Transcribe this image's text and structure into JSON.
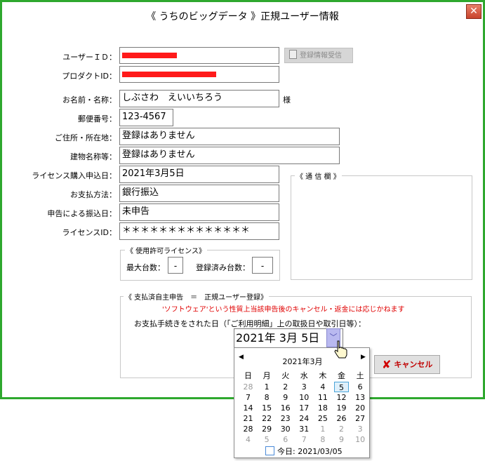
{
  "window": {
    "title": "《 うちのビッグデータ 》正規ユーザー情報",
    "close_glyph": "✕"
  },
  "fields": {
    "user_id": {
      "label": "ユーザーＩＤ：",
      "value": ""
    },
    "product_id": {
      "label": "プロダクトID：",
      "value": ""
    },
    "name": {
      "label": "お名前・名称：",
      "value": "しぶさわ　えいいちろう",
      "suffix": "様"
    },
    "postal": {
      "label": "郵便番号：",
      "value": "123-4567"
    },
    "address": {
      "label": "ご住所・所在地：",
      "value": "登録はありません"
    },
    "building": {
      "label": "建物名称等：",
      "value": "登録はありません"
    },
    "purchase_date": {
      "label": "ライセンス購入申込日：",
      "value": "2021年3月5日"
    },
    "payment_method": {
      "label": "お支払方法：",
      "value": "銀行振込"
    },
    "transfer_date": {
      "label": "申告による振込日：",
      "value": "未申告"
    },
    "license_id": {
      "label": "ライセンスID：",
      "value": "＊＊＊＊＊＊＊＊＊＊＊＊＊＊"
    }
  },
  "receive_button": {
    "label": "登録情報受信"
  },
  "license_group": {
    "title": "《 使用許可ライセンス》",
    "max_label": "最大台数：",
    "max_value": "-",
    "registered_label": "登録済み台数：",
    "registered_value": "-"
  },
  "comm_group": {
    "title": "《 通 信 欄 》"
  },
  "declare_group": {
    "title": "《 支払済自主申告　＝　正規ユーザー登録》",
    "warning": "'ソフトウェア'という性質上当該申告後のキャンセル・返金には応じかねます",
    "prompt": "お支払手続きをされた日（「ご利用明細」上の取扱日や取引日等）：",
    "date_value": "2021年  3月  5日",
    "cancel_label": "キャンセル"
  },
  "calendar": {
    "prev": "◀",
    "next": "▶",
    "month": "2021年3月",
    "weekdays": [
      "日",
      "月",
      "火",
      "水",
      "木",
      "金",
      "土"
    ],
    "weeks": [
      [
        "28",
        "1",
        "2",
        "3",
        "4",
        "5",
        "6"
      ],
      [
        "7",
        "8",
        "9",
        "10",
        "11",
        "12",
        "13"
      ],
      [
        "14",
        "15",
        "16",
        "17",
        "18",
        "19",
        "20"
      ],
      [
        "21",
        "22",
        "23",
        "24",
        "25",
        "26",
        "27"
      ],
      [
        "28",
        "29",
        "30",
        "31",
        "1",
        "2",
        "3"
      ],
      [
        "4",
        "5",
        "6",
        "7",
        "8",
        "9",
        "10"
      ]
    ],
    "today_label": "今日: 2021/03/05"
  }
}
